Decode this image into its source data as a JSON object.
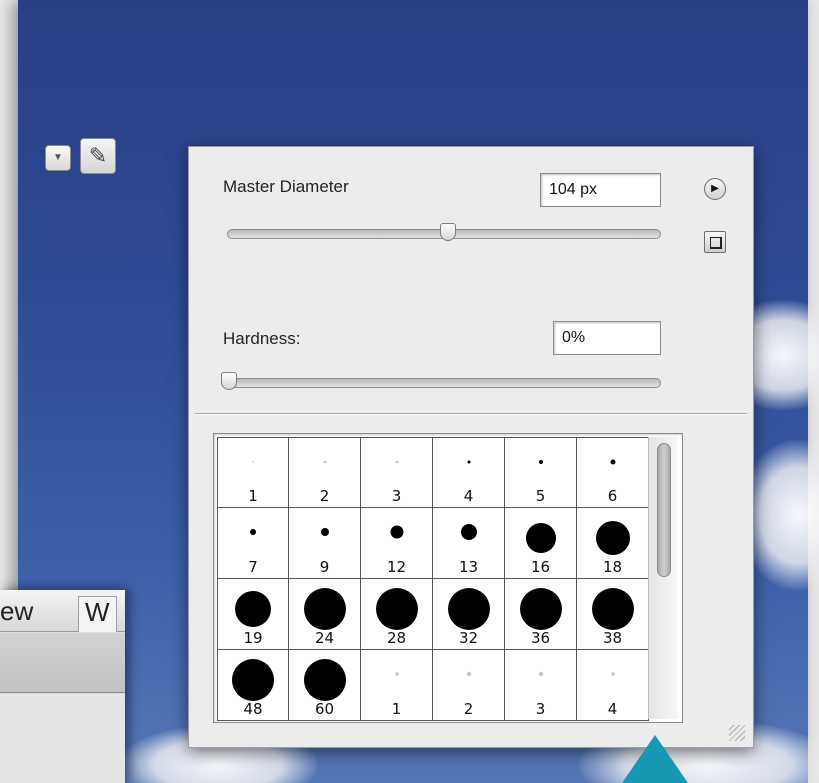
{
  "background": {
    "menu": {
      "items": [
        "ew",
        "W"
      ]
    }
  },
  "brush_panel": {
    "master_diameter": {
      "label": "Master Diameter",
      "value": "104 px",
      "slider_level": 0.51
    },
    "hardness": {
      "label": "Hardness:",
      "value": "0%",
      "slider_level": 0.0
    },
    "menu_button": {
      "icon": "triangle-right-icon",
      "glyph": "▶"
    },
    "save_preset_button": {
      "icon": "new-preset-icon"
    },
    "brush_presets": [
      {
        "size": "1",
        "dot": 2,
        "soft": true
      },
      {
        "size": "2",
        "dot": 3,
        "soft": true
      },
      {
        "size": "3",
        "dot": 3,
        "soft": true
      },
      {
        "size": "4",
        "dot": 3,
        "soft": false
      },
      {
        "size": "5",
        "dot": 4,
        "soft": false
      },
      {
        "size": "6",
        "dot": 5,
        "soft": false
      },
      {
        "size": "7",
        "dot": 6,
        "soft": false
      },
      {
        "size": "9",
        "dot": 8,
        "soft": false
      },
      {
        "size": "12",
        "dot": 13,
        "soft": false
      },
      {
        "size": "13",
        "dot": 16,
        "soft": false
      },
      {
        "size": "16",
        "dot": 30,
        "soft": false
      },
      {
        "size": "18",
        "dot": 34,
        "soft": false
      },
      {
        "size": "19",
        "dot": 36,
        "soft": false
      },
      {
        "size": "24",
        "dot": 42,
        "soft": false
      },
      {
        "size": "28",
        "dot": 42,
        "soft": false
      },
      {
        "size": "32",
        "dot": 42,
        "soft": false
      },
      {
        "size": "36",
        "dot": 42,
        "soft": false
      },
      {
        "size": "38",
        "dot": 42,
        "soft": false
      },
      {
        "size": "48",
        "dot": 42,
        "soft": false
      },
      {
        "size": "60",
        "dot": 42,
        "soft": false
      },
      {
        "size": "1",
        "dot": 4,
        "soft": true
      },
      {
        "size": "2",
        "dot": 5,
        "soft": true
      },
      {
        "size": "3",
        "dot": 5,
        "soft": true
      },
      {
        "size": "4",
        "dot": 4,
        "soft": true
      }
    ]
  },
  "colors": {
    "pointer": "#1798b3",
    "panel_bg": "#ececec"
  }
}
